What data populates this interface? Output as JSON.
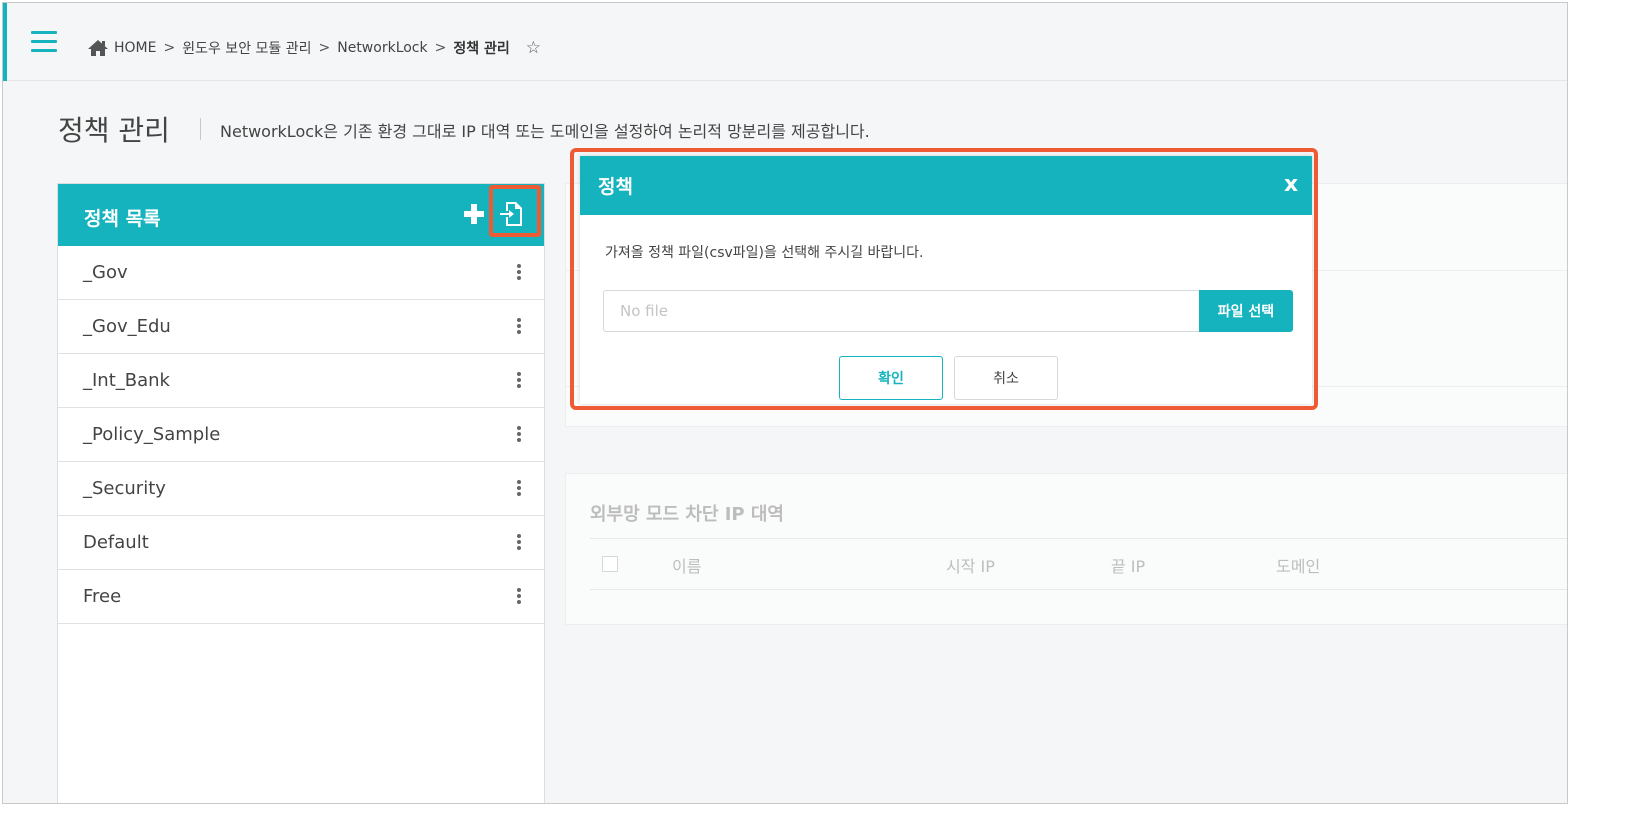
{
  "breadcrumb": {
    "home": "HOME",
    "separator": ">",
    "level1": "윈도우 보안 모듈 관리",
    "level2": "NetworkLock",
    "current": "정책 관리"
  },
  "page": {
    "title": "정책 관리",
    "description": "NetworkLock은 기존 환경 그대로 IP 대역 또는 도메인을 설정하여 논리적 망분리를 제공합니다."
  },
  "policy_panel": {
    "title": "정책 목록",
    "items": [
      {
        "label": "_Gov"
      },
      {
        "label": "_Gov_Edu"
      },
      {
        "label": "_Int_Bank"
      },
      {
        "label": "_Policy_Sample"
      },
      {
        "label": "_Security"
      },
      {
        "label": "Default"
      },
      {
        "label": "Free"
      }
    ]
  },
  "background_block": {
    "title": "외부망 모드 차단 IP 대역",
    "columns": [
      "이름",
      "시작 IP",
      "끝 IP",
      "도메인"
    ]
  },
  "modal": {
    "title": "정책",
    "close_label": "x",
    "message": "가져올 정책 파일(csv파일)을 선택해 주시길 바랍니다.",
    "file_input_placeholder": "No file",
    "file_input_value": "",
    "file_select_label": "파일 선택",
    "confirm_label": "확인",
    "cancel_label": "취소"
  },
  "icons": {
    "menu": "hamburger-menu-icon",
    "home": "home-icon",
    "favorite": "star-outline-icon",
    "add": "plus-icon",
    "import": "file-import-icon",
    "more": "kebab-menu-icon"
  },
  "colors": {
    "accent": "#14b3be",
    "highlight": "#ee5a34"
  }
}
